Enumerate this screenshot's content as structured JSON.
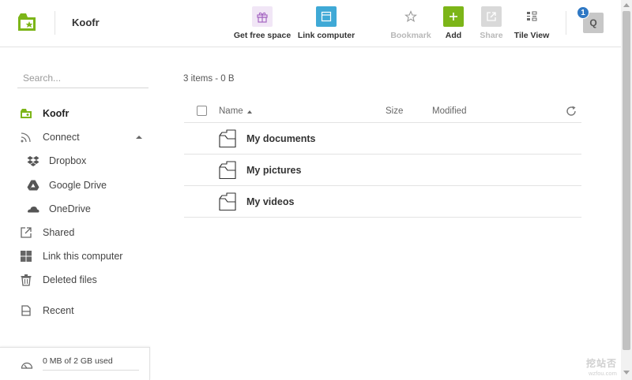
{
  "app": {
    "name": "Koofr",
    "brand_color": "#7cb518"
  },
  "toolbar": {
    "get_free_space": "Get free space",
    "link_computer": "Link computer",
    "bookmark": "Bookmark",
    "add": "Add",
    "share": "Share",
    "tile_view": "Tile View"
  },
  "user": {
    "initial": "Q",
    "notifications": "1"
  },
  "sidebar": {
    "search_placeholder": "Search...",
    "items": [
      {
        "label": "Koofr",
        "icon": "koofr-folder-icon",
        "active": true
      },
      {
        "label": "Connect",
        "icon": "connect-icon"
      },
      {
        "label": "Dropbox",
        "icon": "dropbox-icon"
      },
      {
        "label": "Google Drive",
        "icon": "google-drive-icon"
      },
      {
        "label": "OneDrive",
        "icon": "onedrive-icon"
      },
      {
        "label": "Shared",
        "icon": "shared-icon"
      },
      {
        "label": "Link this computer",
        "icon": "windows-icon"
      },
      {
        "label": "Deleted files",
        "icon": "trash-icon"
      },
      {
        "label": "Recent",
        "icon": "recent-icon"
      }
    ],
    "usage": {
      "text": "0 MB of 2 GB used",
      "fraction": 0.0
    }
  },
  "main": {
    "summary": "3 items - 0 B",
    "columns": {
      "name": "Name",
      "size": "Size",
      "modified": "Modified"
    },
    "files": [
      {
        "name": "My documents"
      },
      {
        "name": "My pictures"
      },
      {
        "name": "My videos"
      }
    ]
  },
  "watermark": {
    "text": "挖站否",
    "url": "wzfou.com"
  }
}
